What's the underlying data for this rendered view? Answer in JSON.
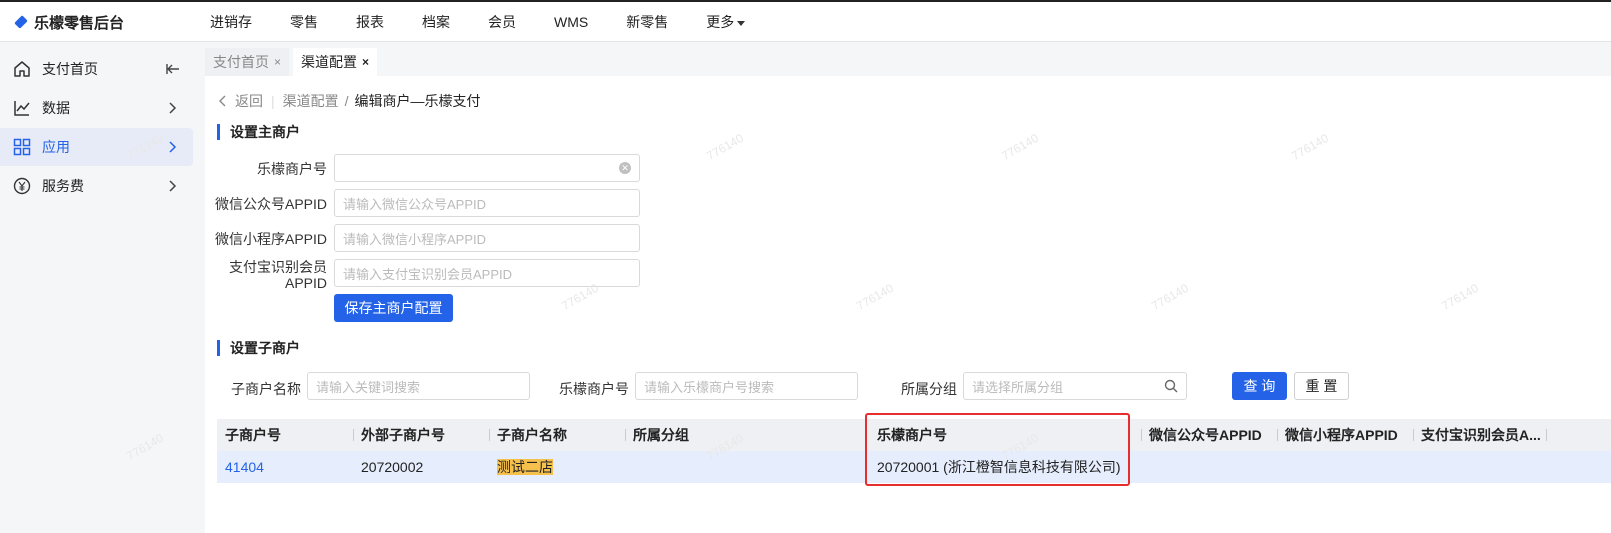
{
  "app": {
    "title": "乐檬零售后台"
  },
  "topnav": [
    "进销存",
    "零售",
    "报表",
    "档案",
    "会员",
    "WMS",
    "新零售",
    "更多"
  ],
  "sidebar": {
    "items": [
      {
        "label": "支付首页",
        "icon": "home-icon"
      },
      {
        "label": "数据",
        "icon": "chart-icon"
      },
      {
        "label": "应用",
        "icon": "apps-icon"
      },
      {
        "label": "服务费",
        "icon": "yen-icon"
      }
    ]
  },
  "tabs": [
    {
      "label": "支付首页",
      "close": "×"
    },
    {
      "label": "渠道配置",
      "close": "×"
    }
  ],
  "breadcrumb": {
    "back": "返回",
    "parent": "渠道配置",
    "sep": "/",
    "current": "编辑商户—乐檬支付"
  },
  "main_merchant": {
    "title": "设置主商户",
    "fields": [
      {
        "label": "乐檬商户号",
        "value": "",
        "placeholder": ""
      },
      {
        "label": "微信公众号APPID",
        "value": "",
        "placeholder": "请输入微信公众号APPID"
      },
      {
        "label": "微信小程序APPID",
        "value": "",
        "placeholder": "请输入微信小程序APPID"
      },
      {
        "label_line1": "支付宝识别会员",
        "label_line2": "APPID",
        "value": "",
        "placeholder": "请输入支付宝识别会员APPID"
      }
    ],
    "save_button": "保存主商户配置"
  },
  "sub_merchant": {
    "title": "设置子商户",
    "filters": {
      "name_label": "子商户名称",
      "name_placeholder": "请输入关键词搜索",
      "lemeng_label": "乐檬商户号",
      "lemeng_placeholder": "请输入乐檬商户号搜索",
      "group_label": "所属分组",
      "group_placeholder": "请选择所属分组"
    },
    "query_button": "查 询",
    "reset_button": "重 置",
    "columns": [
      "子商户号",
      "外部子商户号",
      "子商户名称",
      "所属分组",
      "乐檬商户号",
      "微信公众号APPID",
      "微信小程序APPID",
      "支付宝识别会员A..."
    ],
    "rows": [
      {
        "sub_no": "41404",
        "ext_no": "20720002",
        "name": "测试二店",
        "group": "",
        "lemeng_no": "20720001 (浙江橙智信息科技有限公司)",
        "wx_mp": "",
        "wx_mini": "",
        "alipay": ""
      }
    ]
  },
  "watermark": "776140",
  "colors": {
    "accent": "#2463e8",
    "highlight": "#f6c04d",
    "annotation": "#e62e2e",
    "row_selected": "#e6edfc"
  }
}
